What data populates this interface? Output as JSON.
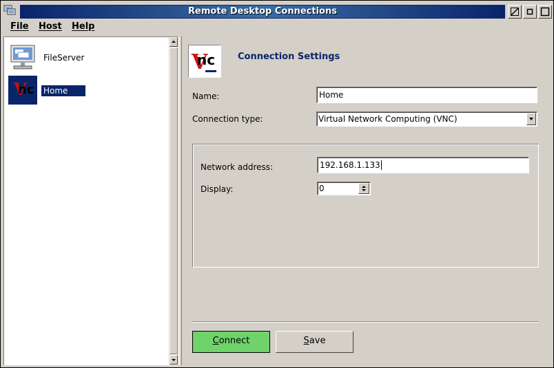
{
  "window": {
    "title": "Remote Desktop Connections",
    "controls": {
      "minimize": "minimize-icon",
      "restore": "restore-icon",
      "maximize": "maximize-icon"
    }
  },
  "menu": {
    "file": "File",
    "host": "Host",
    "help": "Help"
  },
  "hosts": [
    {
      "label": "FileServer",
      "icon": "computer-icon",
      "selected": false
    },
    {
      "label": "Home",
      "icon": "vnc-icon",
      "selected": true
    }
  ],
  "settings": {
    "header_title": "Connection Settings",
    "header_icon": "vnc-icon",
    "name_label": "Name:",
    "name_value": "Home",
    "connection_type_label": "Connection type:",
    "connection_type_value": "Virtual Network Computing (VNC)",
    "network_address_label": "Network address:",
    "network_address_value": "192.168.1.133",
    "display_label": "Display:",
    "display_value": "0"
  },
  "buttons": {
    "connect_label_first": "C",
    "connect_label_rest": "onnect",
    "save_label_first": "S",
    "save_label_rest": "ave"
  },
  "colors": {
    "title_bar": "#0a246a",
    "selection": "#0a246a",
    "connect_button": "#6fd26b",
    "header_title": "#0a246a"
  }
}
